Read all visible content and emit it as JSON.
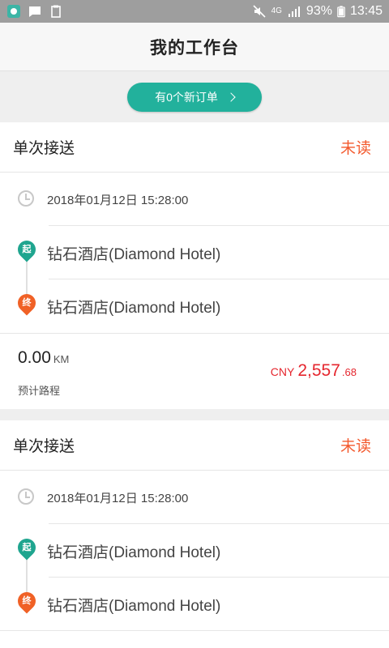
{
  "status_bar": {
    "left_icons": [
      "app-icon",
      "message-icon",
      "clipboard-icon"
    ],
    "right_icons": [
      "mute-icon",
      "network-4g-icon",
      "signal-icon"
    ],
    "network": "4G",
    "battery": "93%",
    "time": "13:45"
  },
  "header": {
    "title": "我的工作台"
  },
  "new_orders": {
    "label": "有0个新订单"
  },
  "orders": [
    {
      "type": "单次接送",
      "status": "未读",
      "datetime": "2018年01月12日 15:28:00",
      "start_badge": "起",
      "start": "钻石酒店(Diamond Hotel)",
      "end_badge": "终",
      "end": "钻石酒店(Diamond Hotel)",
      "distance": "0.00",
      "distance_unit": "KM",
      "distance_label": "预计路程",
      "currency": "CNY",
      "amount": "2,557",
      "amount_decimal": ".68"
    },
    {
      "type": "单次接送",
      "status": "未读",
      "datetime": "2018年01月12日 15:28:00",
      "start_badge": "起",
      "start": "钻石酒店(Diamond Hotel)",
      "end_badge": "终",
      "end": "钻石酒店(Diamond Hotel)"
    }
  ],
  "colors": {
    "accent": "#22b19c",
    "unread": "#f35a2e",
    "price": "#e5262e",
    "start_pin": "#1fa58f",
    "end_pin": "#f06126"
  }
}
